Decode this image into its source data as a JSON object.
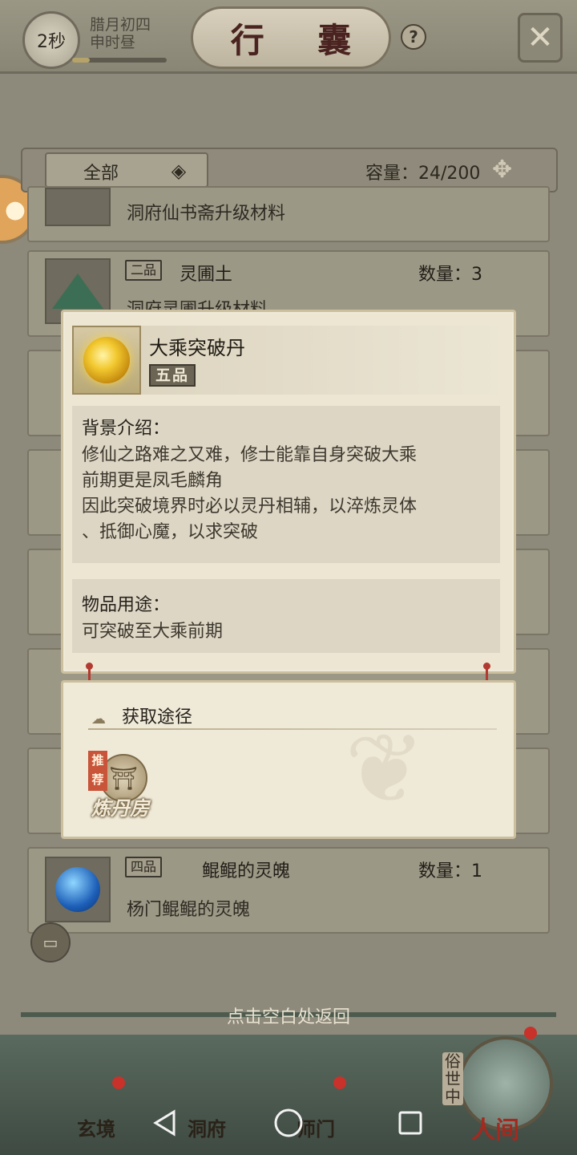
{
  "top_bar": {
    "timer": "2秒",
    "lunar_date": "腊月初四",
    "time_period": "申时昼",
    "title": "行 囊",
    "help": "?",
    "close": "✕"
  },
  "filter": {
    "category": "全部",
    "capacity_label": "容量：24/200"
  },
  "items": [
    {
      "grade": "",
      "name": "",
      "qty": "",
      "desc": "洞府仙书斋升级材料"
    },
    {
      "grade": "二品",
      "name": "灵圃土",
      "qty": "数量：3",
      "desc": "洞府灵圃升级材料"
    },
    {
      "grade": "四品",
      "name": "鲲鲲的灵魄",
      "qty": "数量：1",
      "desc": "杨门鲲鲲的灵魄"
    }
  ],
  "popup": {
    "item_name": "大乘突破丹",
    "item_grade": "五品",
    "background_title": "背景介绍：",
    "background_lines": [
      "修仙之路难之又难，修士能靠自身突破大乘",
      "前期更是凤毛麟角",
      "因此突破境界时必以灵丹相辅，以淬炼灵体",
      "、抵御心魔，以求突破"
    ],
    "usage_title": "物品用途：",
    "usage_text": "可突破至大乘前期"
  },
  "sources": {
    "title": "获取途径",
    "items": [
      {
        "tag": "推荐",
        "label": "炼丹房"
      }
    ]
  },
  "back_hint": "点击空白处返回",
  "bottom_nav": {
    "items": [
      "玄境",
      "洞府",
      "师门",
      "人间"
    ],
    "side_label": "俗世中"
  },
  "icons": {
    "chevron": "chevron-down-icon",
    "move": "move-arrows-icon",
    "chat": "chat-icon",
    "close": "close-icon"
  },
  "colors": {
    "popup_bg": "#ede6d3",
    "accent_red": "#c8322a",
    "grade_badge": "#6c6556"
  }
}
